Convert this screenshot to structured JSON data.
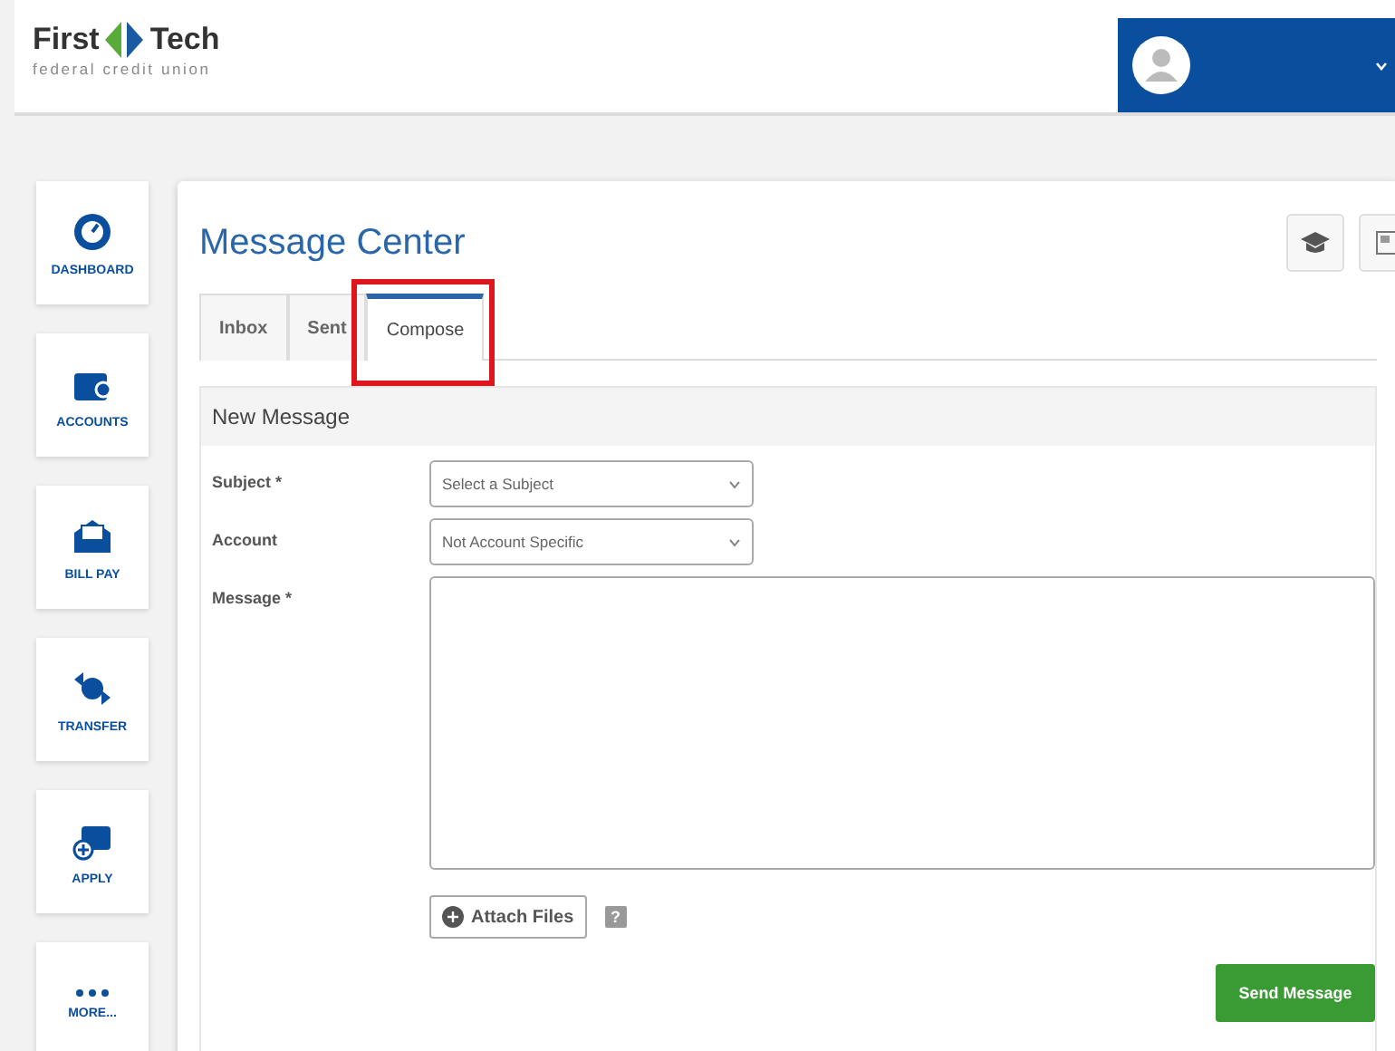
{
  "header": {
    "logo_word_1": "First",
    "logo_word_2": "Tech",
    "tagline": "federal credit union"
  },
  "sidebar": {
    "items": [
      {
        "kind": "dashboard",
        "label": "DASHBOARD"
      },
      {
        "kind": "accounts",
        "label": "ACCOUNTS"
      },
      {
        "kind": "billpay",
        "label": "BILL PAY"
      },
      {
        "kind": "transfer",
        "label": "TRANSFER"
      },
      {
        "kind": "apply",
        "label": "APPLY"
      },
      {
        "kind": "more",
        "label": "MORE..."
      }
    ]
  },
  "page": {
    "title": "Message Center"
  },
  "tabs": [
    {
      "label": "Inbox",
      "selected": false,
      "highlighted": false
    },
    {
      "label": "Sent",
      "selected": false,
      "highlighted": false
    },
    {
      "label": "Compose",
      "selected": true,
      "highlighted": true
    }
  ],
  "form": {
    "title": "New Message",
    "fields": [
      {
        "kind": "select",
        "label": "Subject *",
        "value": "Select a Subject"
      },
      {
        "kind": "select",
        "label": "Account",
        "value": "Not Account Specific"
      },
      {
        "kind": "textarea",
        "label": "Message *"
      }
    ],
    "attach_button": "Attach Files",
    "help": "?",
    "send_button": "Send Message"
  }
}
